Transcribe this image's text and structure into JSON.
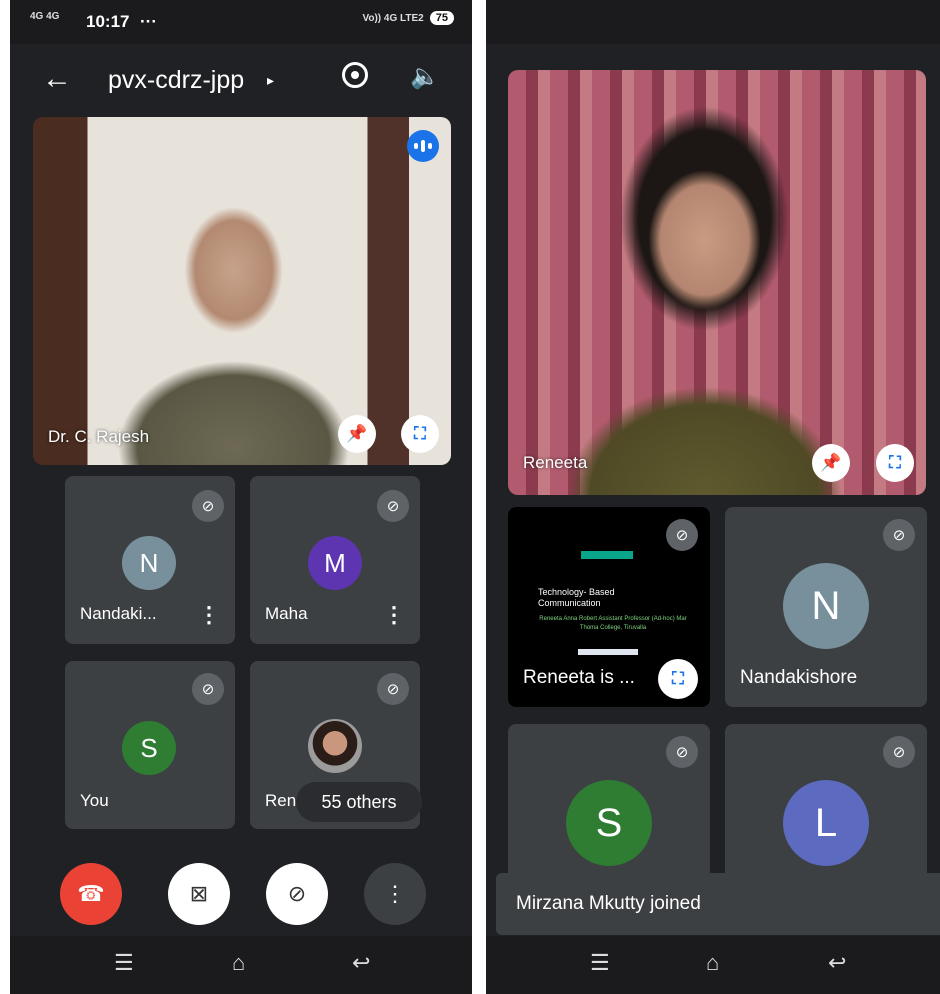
{
  "left": {
    "status": {
      "signal": "4G 4G",
      "time": "10:17",
      "overflow": "···",
      "network": "Vo)) 4G LTE2",
      "battery": "75"
    },
    "meeting_code": "pvx-cdrz-jpp",
    "featured": {
      "name": "Dr. C. Rajesh"
    },
    "tiles": [
      {
        "name": "Nandaki...",
        "initial": "N",
        "color": "#78909c"
      },
      {
        "name": "Maha",
        "initial": "M",
        "color": "#5e35b1"
      },
      {
        "name": "You",
        "initial": "S",
        "color": "#2e7d32"
      },
      {
        "name": "Reneeta",
        "initial": "",
        "color": ""
      }
    ],
    "others_chip": "55 others"
  },
  "right": {
    "featured": {
      "name": "Reneeta"
    },
    "presentation": {
      "label": "Reneeta is ...",
      "slide_title": "Technology- Based Communication",
      "slide_subtitle": "Reneeta Anna Robert Assistant Professor (Ad-hoc) Mar Thoma College, Tiruvalla"
    },
    "tiles": [
      {
        "name": "Nandakishore",
        "initial": "N",
        "color": "#78909c"
      },
      {
        "name": "",
        "initial": "S",
        "color": "#2e7d32"
      },
      {
        "name": "",
        "initial": "L",
        "color": "#5c6bc0"
      }
    ],
    "toast": "Mirzana Mkutty joined"
  },
  "icons": {
    "back": "←",
    "caret": "▸",
    "speaker": "🔈",
    "mute": "mic-off-icon",
    "pin": "pin-icon",
    "fullscreen": "fullscreen-icon"
  },
  "colors": {
    "end_call": "#ea4335",
    "accent": "#1a73e8",
    "tile": "#3c4043"
  }
}
